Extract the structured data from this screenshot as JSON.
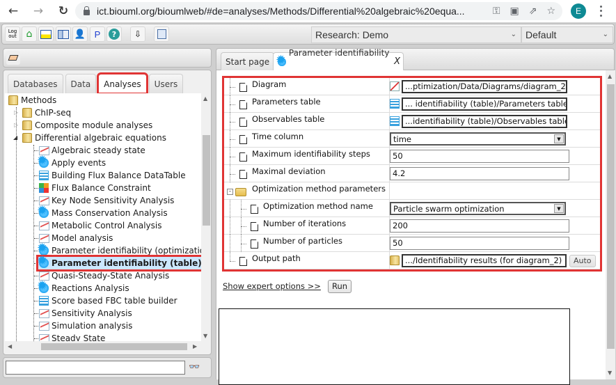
{
  "browser": {
    "url": "ict.biouml.org/bioumlweb/#de=analyses/Methods/Differential%20algebraic%20equa...",
    "back_icon": "arrow-left-icon",
    "forward_icon": "arrow-right-icon",
    "reload_icon": "reload-icon",
    "profile_initial": "E",
    "profile_color": "#0e8a94"
  },
  "toolbar": {
    "logout_label": "Log out",
    "research_select": "Research: Demo",
    "perspective_select": "Default",
    "buttons": [
      "logout-icon",
      "home-icon",
      "layout-icon",
      "panel-icon",
      "user-icon",
      "p-icon",
      "help-icon",
      "import-icon",
      "diagram-icon"
    ],
    "p_label": "P",
    "help_label": "?"
  },
  "left": {
    "tabs": [
      {
        "label": "Databases",
        "active": false
      },
      {
        "label": "Data",
        "active": false
      },
      {
        "label": "Analyses",
        "active": true
      },
      {
        "label": "Users",
        "active": false
      }
    ],
    "tree": {
      "root": "Methods",
      "folders": [
        "ChIP-seq",
        "Composite module analyses",
        "Differential algebraic equations"
      ],
      "items": [
        {
          "label": "Algebraic steady state",
          "icon": "chart"
        },
        {
          "label": "Apply events",
          "icon": "gear"
        },
        {
          "label": "Building Flux Balance DataTable",
          "icon": "table-flux"
        },
        {
          "label": "Flux Balance Constraint",
          "icon": "flux"
        },
        {
          "label": "Key Node Sensitivity Analysis",
          "icon": "chart"
        },
        {
          "label": "Mass Conservation Analysis",
          "icon": "gear"
        },
        {
          "label": "Metabolic Control Analysis",
          "icon": "chart"
        },
        {
          "label": "Model analysis",
          "icon": "chart"
        },
        {
          "label": "Parameter identifiability (optimization)",
          "icon": "gear"
        },
        {
          "label": "Parameter identifiability (table)",
          "icon": "gear",
          "selected": true
        },
        {
          "label": "Quasi-Steady-State Analysis",
          "icon": "chart"
        },
        {
          "label": "Reactions Analysis",
          "icon": "gear"
        },
        {
          "label": "Score based FBC table builder",
          "icon": "table-flux"
        },
        {
          "label": "Sensitivity Analysis",
          "icon": "chart"
        },
        {
          "label": "Simulation analysis",
          "icon": "chart"
        },
        {
          "label": "Steady State",
          "icon": "chart"
        }
      ]
    },
    "search": {
      "value": "",
      "placeholder": ""
    }
  },
  "right": {
    "tabs": [
      {
        "label": "Start page"
      },
      {
        "label": "Parameter identifiability ...",
        "active": true,
        "close": "X"
      }
    ],
    "params": [
      {
        "label": "Diagram",
        "value": "...ptimization/Data/Diagrams/diagram_2",
        "type": "path-diagram"
      },
      {
        "label": "Parameters table",
        "value": "... identifiability (table)/Parameters table",
        "type": "path-table"
      },
      {
        "label": "Observables table",
        "value": "...identifiability (table)/Observables table",
        "type": "path-table"
      },
      {
        "label": "Time column",
        "value": "time",
        "type": "select"
      },
      {
        "label": "Maximum identifiability steps",
        "value": "50",
        "type": "text"
      },
      {
        "label": "Maximal deviation",
        "value": "4.2",
        "type": "text"
      },
      {
        "label": "Optimization method parameters",
        "type": "group"
      },
      {
        "label": "Optimization method name",
        "value": "Particle swarm optimization",
        "type": "select",
        "child": true
      },
      {
        "label": "Number of iterations",
        "value": "200",
        "type": "text",
        "child": true
      },
      {
        "label": "Number of particles",
        "value": "50",
        "type": "text",
        "child": true
      },
      {
        "label": "Output path",
        "value": ".../Identifiability results (for diagram_2)",
        "type": "path-folder",
        "button": "Auto"
      }
    ],
    "expert_link": "Show expert options >>",
    "run_label": "Run",
    "highlight_color": "#e03434"
  }
}
